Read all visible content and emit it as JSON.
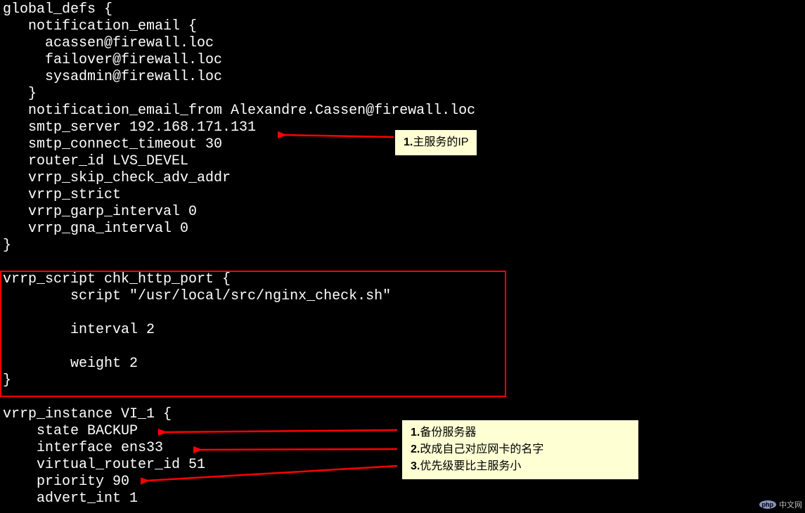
{
  "config": {
    "line1": "global_defs {",
    "line2": "   notification_email {",
    "line3": "     acassen@firewall.loc",
    "line4": "     failover@firewall.loc",
    "line5": "     sysadmin@firewall.loc",
    "line6": "   }",
    "line7": "   notification_email_from Alexandre.Cassen@firewall.loc",
    "line8": "   smtp_server 192.168.171.131",
    "line9": "   smtp_connect_timeout 30",
    "line10": "   router_id LVS_DEVEL",
    "line11": "   vrrp_skip_check_adv_addr",
    "line12": "   vrrp_strict",
    "line13": "   vrrp_garp_interval 0",
    "line14": "   vrrp_gna_interval 0",
    "line15": "}",
    "line16": "",
    "line17": "vrrp_script chk_http_port {",
    "line18": "        script \"/usr/local/src/nginx_check.sh\"",
    "line19": "",
    "line20": "        interval 2",
    "line21": "",
    "line22": "        weight 2",
    "line23": "}",
    "line24": "",
    "line25": "vrrp_instance VI_1 {",
    "line26": "    state BACKUP",
    "line27": "    interface ens33",
    "line28": "    virtual_router_id 51",
    "line29": "    priority 90",
    "line30": "    advert_int 1"
  },
  "annotation1": {
    "prefix": "1.",
    "text": "主服务的IP"
  },
  "annotation2": {
    "item1_prefix": "1.",
    "item1_text": "备份服务器",
    "item2_prefix": "2.",
    "item2_text": "改成自己对应网卡的名字",
    "item3_prefix": "3.",
    "item3_text": "优先级要比主服务小"
  },
  "watermark": {
    "php": "php",
    "text": "中文网"
  }
}
